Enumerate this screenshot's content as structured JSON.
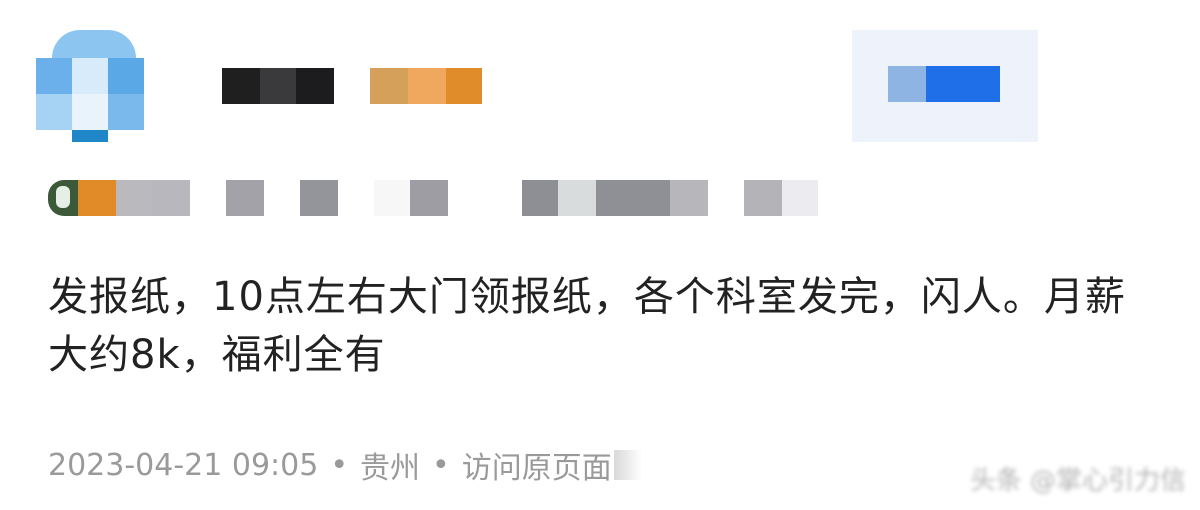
{
  "post": {
    "text": "发报纸，10点左右大门领报纸，各个科室发完，闪人。月薪大约8k，福利全有",
    "timestamp": "2023-04-21 09:05",
    "location": "贵州",
    "separator": "•",
    "view_source": "访问原页面"
  },
  "watermark": "头条 @掌心引力信",
  "colors": {
    "avatar_blue": "#5aa8e6",
    "text": "#222222",
    "meta": "#9a9a9a",
    "follow_blue": "#1f6fe8"
  }
}
